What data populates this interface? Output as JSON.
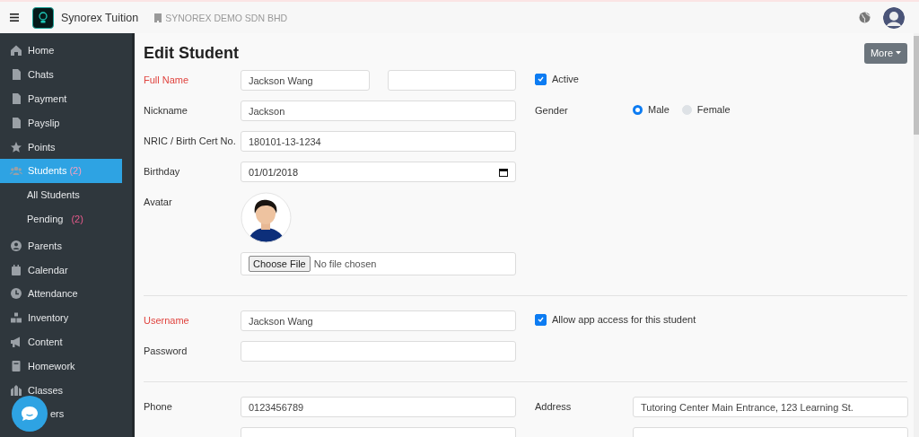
{
  "topbar": {
    "app_name": "Synorex Tuition",
    "company": "SYNOREX DEMO SDN BHD"
  },
  "sidebar": {
    "items": [
      {
        "kind": "item",
        "label": "Home",
        "selected": false
      },
      {
        "kind": "item",
        "label": "Chats",
        "selected": false
      },
      {
        "kind": "item",
        "label": "Payment",
        "selected": false
      },
      {
        "kind": "item",
        "label": "Payslip",
        "selected": false
      },
      {
        "kind": "item",
        "label": "Points",
        "selected": false
      },
      {
        "kind": "item",
        "label": "Students",
        "count": "(2)",
        "selected": true,
        "children": [
          {
            "label": "All Students",
            "selected": false
          },
          {
            "label": "Pending",
            "count": "(2)",
            "selected": false
          }
        ]
      },
      {
        "kind": "item",
        "label": "Parents",
        "selected": false
      },
      {
        "kind": "item",
        "label": "Calendar",
        "selected": false
      },
      {
        "kind": "item",
        "label": "Attendance",
        "selected": false
      },
      {
        "kind": "item",
        "label": "Inventory",
        "selected": false
      },
      {
        "kind": "item",
        "label": "Content",
        "selected": false
      },
      {
        "kind": "item",
        "label": "Homework",
        "selected": false
      },
      {
        "kind": "item",
        "label": "Classes",
        "selected": false
      },
      {
        "kind": "covered",
        "label": "ers",
        "selected": false
      }
    ]
  },
  "page": {
    "title": "Edit Student",
    "more_button": "More"
  },
  "sections": [
    {
      "rows": [
        {
          "left": {
            "kind": "text",
            "label": "Full Name",
            "required": true,
            "value": "Jackson Wang",
            "extra_input": true
          },
          "right": {
            "kind": "checkbox",
            "label": "Active",
            "checked": true
          }
        },
        {
          "left": {
            "kind": "text",
            "label": "Nickname",
            "required": false,
            "value": "Jackson"
          },
          "right": {
            "kind": "radio",
            "label": "Gender",
            "options": [
              {
                "label": "Male",
                "selected": true
              },
              {
                "label": "Female",
                "selected": false
              }
            ]
          }
        },
        {
          "left": {
            "kind": "text",
            "label": "NRIC / Birth Cert No.",
            "required": false,
            "value": "180101-13-1234"
          }
        },
        {
          "left": {
            "kind": "date",
            "label": "Birthday",
            "required": false,
            "value": "01/01/2018"
          }
        },
        {
          "left": {
            "kind": "avatar",
            "label": "Avatar",
            "required": false,
            "button": "Choose File",
            "file_status": "No file chosen"
          }
        }
      ]
    },
    {
      "rows": [
        {
          "left": {
            "kind": "text",
            "label": "Username",
            "required": true,
            "value": "Jackson Wang"
          },
          "right": {
            "kind": "checkbox",
            "label": "Allow app access for this student",
            "checked": true
          }
        },
        {
          "left": {
            "kind": "text",
            "label": "Password",
            "required": false
          }
        }
      ]
    },
    {
      "rows": [
        {
          "left": {
            "kind": "text",
            "label": "Phone",
            "required": false,
            "value": "0123456789"
          },
          "right": {
            "kind": "text",
            "label": "Address",
            "required": false,
            "value": "Tutoring Center Main Entrance, 123 Learning St."
          }
        },
        {
          "left": {
            "kind": "text"
          },
          "right": {
            "kind": "text"
          }
        }
      ]
    }
  ]
}
